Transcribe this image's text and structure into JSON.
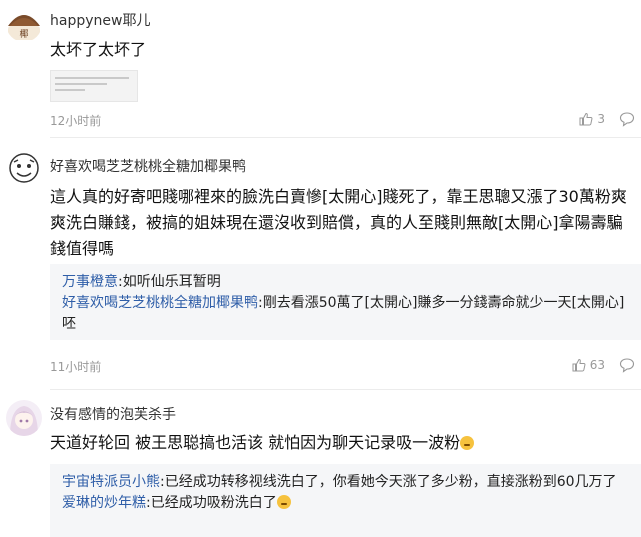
{
  "comments": [
    {
      "user": "happynew耶儿",
      "avatar_icon": "coconut-avatar-icon",
      "text": "太坏了太坏了",
      "time": "12小时前",
      "likes": "3",
      "attachment_icon": "screenshot-thumbnail-icon"
    },
    {
      "user": "好喜欢喝芝芝桃桃全糖加椰果鸭",
      "avatar_icon": "cartoon-face-avatar-icon",
      "text": "這人真的好寄吧賤哪裡來的臉洗白賣慘[太開心]賤死了，靠王思聰又漲了30萬粉爽爽洗白賺錢，被搞的姐妹現在還沒收到賠償，真的人至賤則無敵[太開心]拿陽壽騙錢值得嗎",
      "time": "11小时前",
      "likes": "63",
      "replies": [
        {
          "name": "万事橙意",
          "text": ":如听仙乐耳暂明"
        },
        {
          "name": "好喜欢喝芝芝桃桃全糖加椰果鸭",
          "text": ":剛去看漲50萬了[太開心]賺多一分錢壽命就少一天[太開心]呸"
        }
      ]
    },
    {
      "user": "没有感情的泡芙杀手",
      "avatar_icon": "anime-girl-avatar-icon",
      "text": "天道好轮回 被王思聪搞也活该 就怕因为聊天记录吸一波粉",
      "emoji_icon": "crying-face-emoji-icon",
      "replies": [
        {
          "name": "宇宙特派员小熊",
          "text": ":已经成功转移视线洗白了，你看她今天涨了多少粉，直接涨粉到60几万了"
        },
        {
          "name": "爱琳的炒年糕",
          "text": ":已经成功吸粉洗白了",
          "emoji_icon": "crying-face-emoji-icon"
        }
      ]
    }
  ],
  "icons": {
    "like": "thumbs-up-icon",
    "reply": "speech-bubble-icon"
  },
  "colors": {
    "username_link": "#2f5ea8",
    "meta_gray": "#999999",
    "reply_background": "#f5f6f8"
  }
}
